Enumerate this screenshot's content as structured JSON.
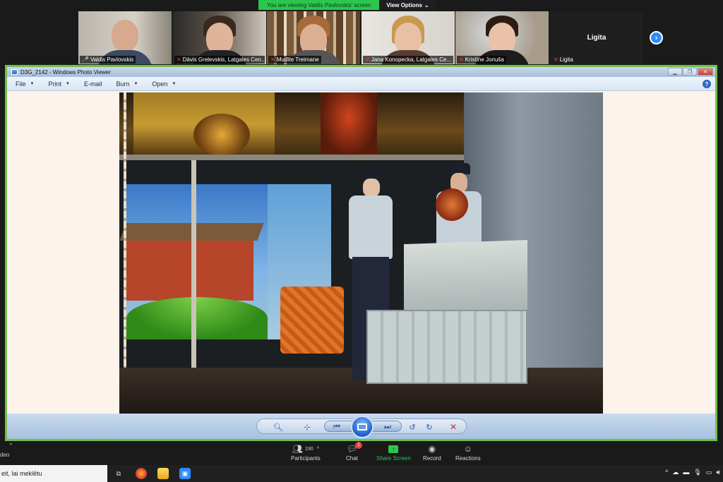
{
  "zoom": {
    "banner_text": "You are viewing Valdis Pavlovskis' screen",
    "view_options": "View Options",
    "participants": [
      {
        "name": "Valdis Pavlovskis",
        "muted": false
      },
      {
        "name": "Dāvis Grelevskis, Latgales Cen...",
        "muted": true
      },
      {
        "name": "Mudīte Treimane",
        "muted": true
      },
      {
        "name": "Jana Konopecka, Latgales Ce...",
        "muted": true
      },
      {
        "name": "Kristīne Jonuša",
        "muted": true
      },
      {
        "name": "Ligita",
        "muted": true
      }
    ],
    "name_only_tile": "Ligita",
    "toolbar": {
      "video_label": "deo",
      "participants_label": "Participants",
      "participants_count": "190",
      "chat_label": "Chat",
      "chat_badge": "1",
      "share_label": "Share Screen",
      "record_label": "Record",
      "reactions_label": "Reactions"
    }
  },
  "photo_viewer": {
    "window_title": "D3G_2142 - Windows Photo Viewer",
    "menu": [
      "File",
      "Print",
      "E-mail",
      "Burn",
      "Open"
    ],
    "menu_has_caret": [
      true,
      true,
      false,
      true,
      true
    ]
  },
  "taskbar": {
    "search_text": "eit, lai meklētu"
  },
  "colors": {
    "zoom_green": "#2bc74d",
    "share_border": "#6fc049",
    "zoom_blue": "#2d8cff"
  }
}
